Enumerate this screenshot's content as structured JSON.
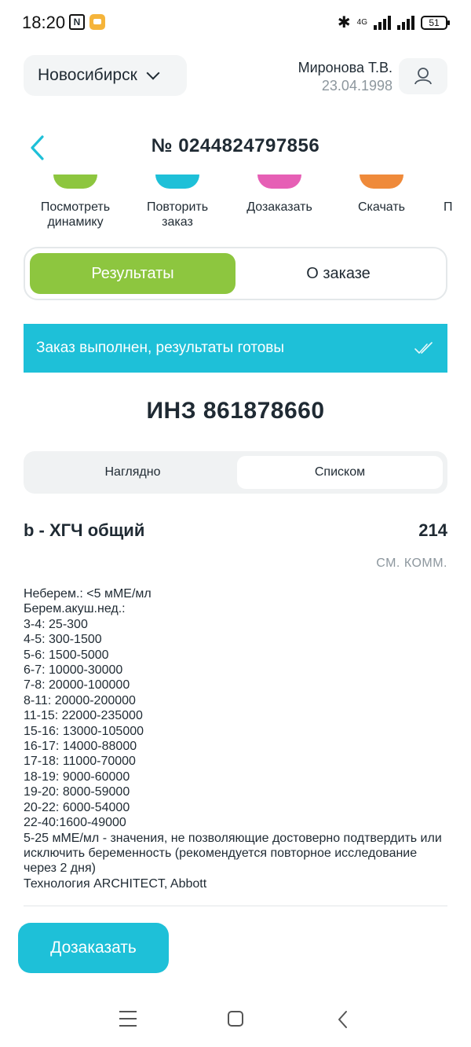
{
  "status_bar": {
    "time": "18:20",
    "nfc": "N",
    "network": "4G",
    "battery": "51"
  },
  "header": {
    "city": "Новосибирск",
    "user_name": "Миронова Т.В.",
    "user_dob": "23.04.1998"
  },
  "order": {
    "title": "№ 0244824797856"
  },
  "actions": [
    {
      "label": "Посмотреть динамику",
      "color": "#8dc63f"
    },
    {
      "label": "Повторить заказ",
      "color": "#1ec0d8"
    },
    {
      "label": "Дозаказать",
      "color": "#e65fb5"
    },
    {
      "label": "Скачать",
      "color": "#ef8a3a"
    },
    {
      "label": "П",
      "color": "#8a8a8a"
    }
  ],
  "tabs": {
    "results": "Результаты",
    "about": "О заказе"
  },
  "banner": {
    "text": "Заказ выполнен, результаты готовы"
  },
  "inz": "ИНЗ 861878660",
  "view_toggle": {
    "visual": "Наглядно",
    "list": "Списком"
  },
  "test": {
    "name": "b - ХГЧ общий",
    "value": "214",
    "comment": "СМ. КОММ.",
    "reference": "Неберем.: <5 мМЕ/мл\nБерем.акуш.нед.:\n3-4: 25-300\n4-5: 300-1500\n5-6: 1500-5000\n6-7: 10000-30000\n7-8: 20000-100000\n8-11: 20000-200000\n11-15: 22000-235000\n15-16: 13000-105000\n16-17: 14000-88000\n17-18: 11000-70000\n18-19: 9000-60000\n19-20: 8000-59000\n20-22: 6000-54000\n22-40:1600-49000\n5-25 мМЕ/мл - значения, не позволяющие достоверно подтвердить или исключить беременность (рекомендуется повторное исследование через 2 дня)\nТехнология ARCHITECT, Abbott"
  },
  "reorder_button": "Дозаказать"
}
